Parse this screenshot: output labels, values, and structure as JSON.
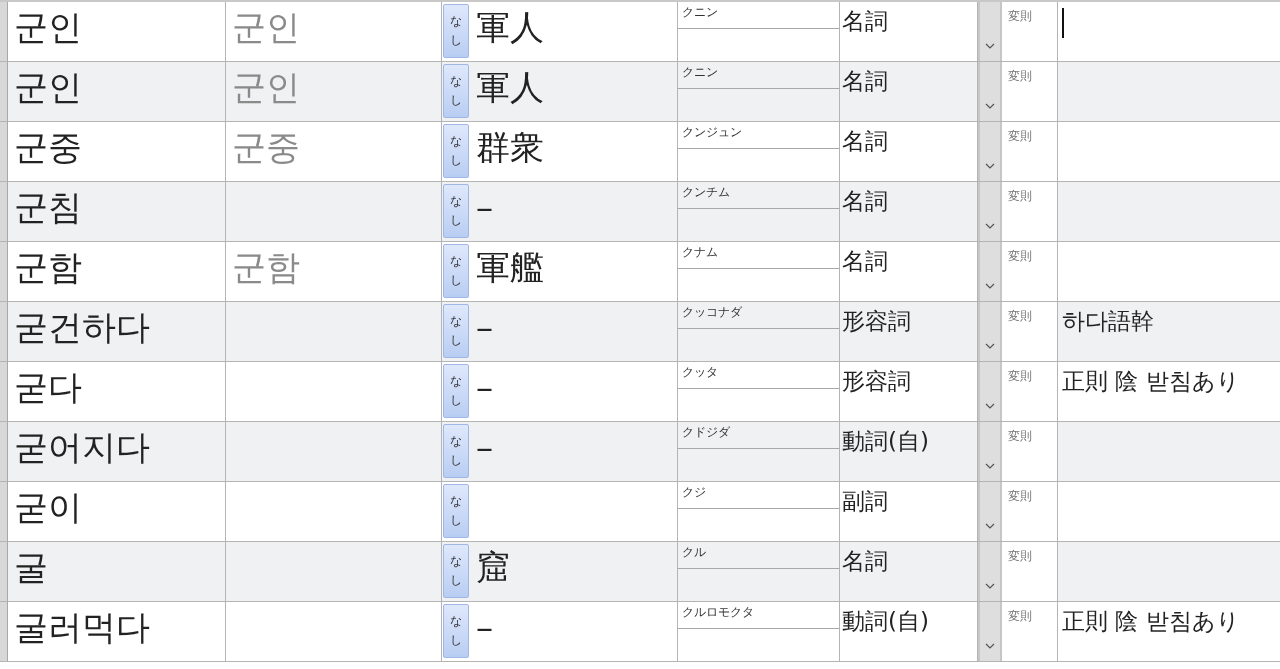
{
  "rows": [
    {
      "word": "군인",
      "base": "군인",
      "button": "なし",
      "kanji": "軍人",
      "reading": "クニン",
      "pos": "名詞",
      "irregular": "変則",
      "note": "",
      "cursor": true
    },
    {
      "word": "군인",
      "base": "군인",
      "button": "なし",
      "kanji": "軍人",
      "reading": "クニン",
      "pos": "名詞",
      "irregular": "変則",
      "note": "",
      "cursor": false
    },
    {
      "word": "군중",
      "base": "군중",
      "button": "なし",
      "kanji": "群衆",
      "reading": "クンジュン",
      "pos": "名詞",
      "irregular": "変則",
      "note": "",
      "cursor": false
    },
    {
      "word": "군침",
      "base": "",
      "button": "なし",
      "kanji": "–",
      "reading": "クンチム",
      "pos": "名詞",
      "irregular": "変則",
      "note": "",
      "cursor": false
    },
    {
      "word": "군함",
      "base": "군함",
      "button": "なし",
      "kanji": "軍艦",
      "reading": "クナム",
      "pos": "名詞",
      "irregular": "変則",
      "note": "",
      "cursor": false
    },
    {
      "word": "굳건하다",
      "base": "",
      "button": "なし",
      "kanji": "–",
      "reading": "クッコナダ",
      "pos": "形容詞",
      "irregular": "変則",
      "note": "하다語幹",
      "cursor": false
    },
    {
      "word": "굳다",
      "base": "",
      "button": "なし",
      "kanji": "–",
      "reading": "クッタ",
      "pos": "形容詞",
      "irregular": "変則",
      "note": "正則 陰 받침あり",
      "cursor": false
    },
    {
      "word": "굳어지다",
      "base": "",
      "button": "なし",
      "kanji": "–",
      "reading": "クドジダ",
      "pos": "動詞(自)",
      "irregular": "変則",
      "note": "",
      "cursor": false
    },
    {
      "word": "굳이",
      "base": "",
      "button": "なし",
      "kanji": "",
      "reading": "クジ",
      "pos": "副詞",
      "irregular": "変則",
      "note": "",
      "cursor": false
    },
    {
      "word": "굴",
      "base": "",
      "button": "なし",
      "kanji": "窟",
      "reading": "クル",
      "pos": "名詞",
      "irregular": "変則",
      "note": "",
      "cursor": false
    },
    {
      "word": "굴러먹다",
      "base": "",
      "button": "なし",
      "kanji": "–",
      "reading": "クルロモクタ",
      "pos": "動詞(自)",
      "irregular": "変則",
      "note": "正則 陰 받침あり",
      "cursor": false
    }
  ]
}
